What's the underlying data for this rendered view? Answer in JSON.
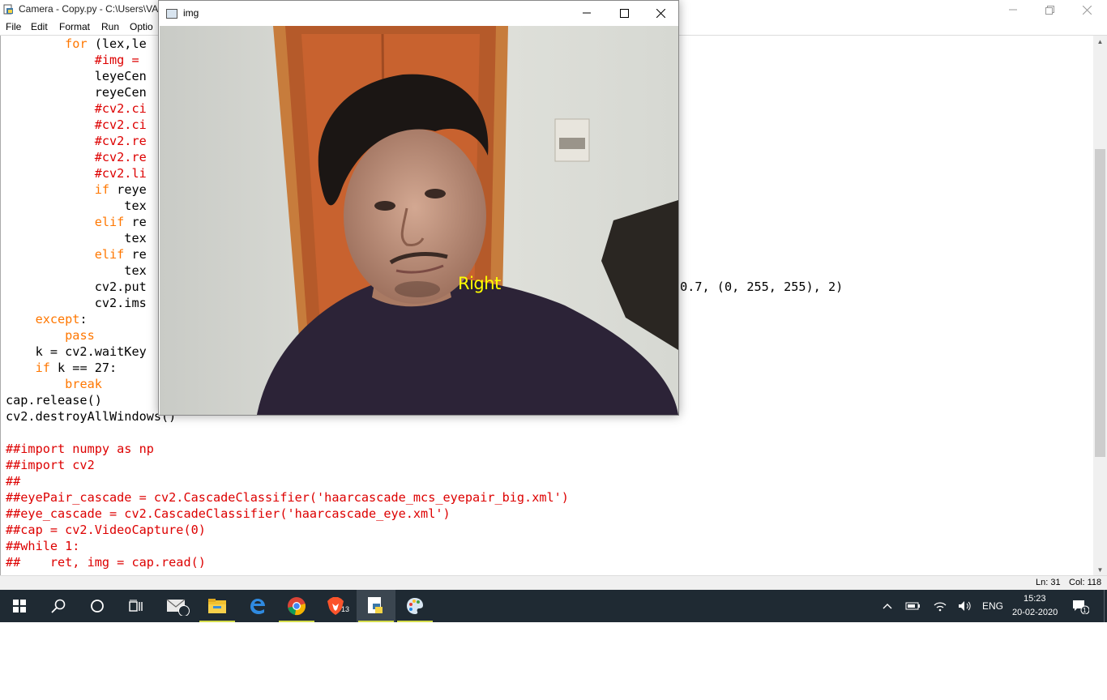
{
  "idle": {
    "title": "Camera - Copy.py - C:\\Users\\VA",
    "menu": [
      "File",
      "Edit",
      "Format",
      "Run",
      "Optio"
    ],
    "status": {
      "ln": "Ln: 31",
      "col": "Col: 118"
    },
    "code": [
      [
        {
          "t": "        ",
          "c": "blk"
        },
        {
          "t": "for",
          "c": "or"
        },
        {
          "t": " (lex,le",
          "c": "blk"
        }
      ],
      [
        {
          "t": "            ",
          "c": "blk"
        },
        {
          "t": "#img = ",
          "c": "red"
        }
      ],
      [
        {
          "t": "            leyeCen",
          "c": "blk"
        }
      ],
      [
        {
          "t": "            reyeCen",
          "c": "blk"
        }
      ],
      [
        {
          "t": "            ",
          "c": "blk"
        },
        {
          "t": "#cv2.ci",
          "c": "red"
        }
      ],
      [
        {
          "t": "            ",
          "c": "blk"
        },
        {
          "t": "#cv2.ci",
          "c": "red"
        }
      ],
      [
        {
          "t": "            ",
          "c": "blk"
        },
        {
          "t": "#cv2.re",
          "c": "red"
        }
      ],
      [
        {
          "t": "            ",
          "c": "blk"
        },
        {
          "t": "#cv2.re",
          "c": "red"
        }
      ],
      [
        {
          "t": "            ",
          "c": "blk"
        },
        {
          "t": "#cv2.li",
          "c": "red"
        }
      ],
      [
        {
          "t": "            ",
          "c": "blk"
        },
        {
          "t": "if",
          "c": "or"
        },
        {
          "t": " reye",
          "c": "blk"
        }
      ],
      [
        {
          "t": "                tex",
          "c": "blk"
        }
      ],
      [
        {
          "t": "            ",
          "c": "blk"
        },
        {
          "t": "elif",
          "c": "or"
        },
        {
          "t": " re",
          "c": "blk"
        }
      ],
      [
        {
          "t": "                tex",
          "c": "blk"
        }
      ],
      [
        {
          "t": "            ",
          "c": "blk"
        },
        {
          "t": "elif",
          "c": "or"
        },
        {
          "t": " re",
          "c": "blk"
        }
      ],
      [
        {
          "t": "                tex",
          "c": "blk"
        }
      ],
      [
        {
          "t": "            cv2.put",
          "c": "blk"
        },
        {
          "t": "                                                      _HERSHEY_SIMPLEX, 0.7, (0, 255, 255), 2)",
          "c": "blk"
        }
      ],
      [
        {
          "t": "            cv2.ims",
          "c": "blk"
        }
      ],
      [
        {
          "t": "    ",
          "c": "blk"
        },
        {
          "t": "except",
          "c": "or"
        },
        {
          "t": ":",
          "c": "blk"
        }
      ],
      [
        {
          "t": "        ",
          "c": "blk"
        },
        {
          "t": "pass",
          "c": "or"
        }
      ],
      [
        {
          "t": "    k = cv2.waitKey",
          "c": "blk"
        }
      ],
      [
        {
          "t": "    ",
          "c": "blk"
        },
        {
          "t": "if",
          "c": "or"
        },
        {
          "t": " k == 27:",
          "c": "blk"
        }
      ],
      [
        {
          "t": "        ",
          "c": "blk"
        },
        {
          "t": "break",
          "c": "or"
        }
      ],
      [
        {
          "t": "cap.release()",
          "c": "blk"
        }
      ],
      [
        {
          "t": "cv2.destroyAllWindows()",
          "c": "blk"
        }
      ],
      [
        {
          "t": "",
          "c": "blk"
        }
      ],
      [
        {
          "t": "##import numpy as np",
          "c": "red"
        }
      ],
      [
        {
          "t": "##import cv2",
          "c": "red"
        }
      ],
      [
        {
          "t": "##",
          "c": "red"
        }
      ],
      [
        {
          "t": "##eyePair_cascade = cv2.CascadeClassifier('haarcascade_mcs_eyepair_big.xml')",
          "c": "red"
        }
      ],
      [
        {
          "t": "##eye_cascade = cv2.CascadeClassifier('haarcascade_eye.xml')",
          "c": "red"
        }
      ],
      [
        {
          "t": "##cap = cv2.VideoCapture(0)",
          "c": "red"
        }
      ],
      [
        {
          "t": "##while 1:",
          "c": "red"
        }
      ],
      [
        {
          "t": "##    ret, img = cap.read()",
          "c": "red"
        }
      ]
    ]
  },
  "img_window": {
    "title": "img",
    "overlay_text": "Right"
  },
  "taskbar": {
    "mail_badge": "13",
    "lang": "ENG",
    "time": "15:23",
    "date": "20-02-2020",
    "notification_count": "1"
  },
  "colors": {
    "keyword": "#ff7700",
    "comment": "#dd0000",
    "overlay": "#ffff00",
    "taskbar": "#1f2a33"
  }
}
